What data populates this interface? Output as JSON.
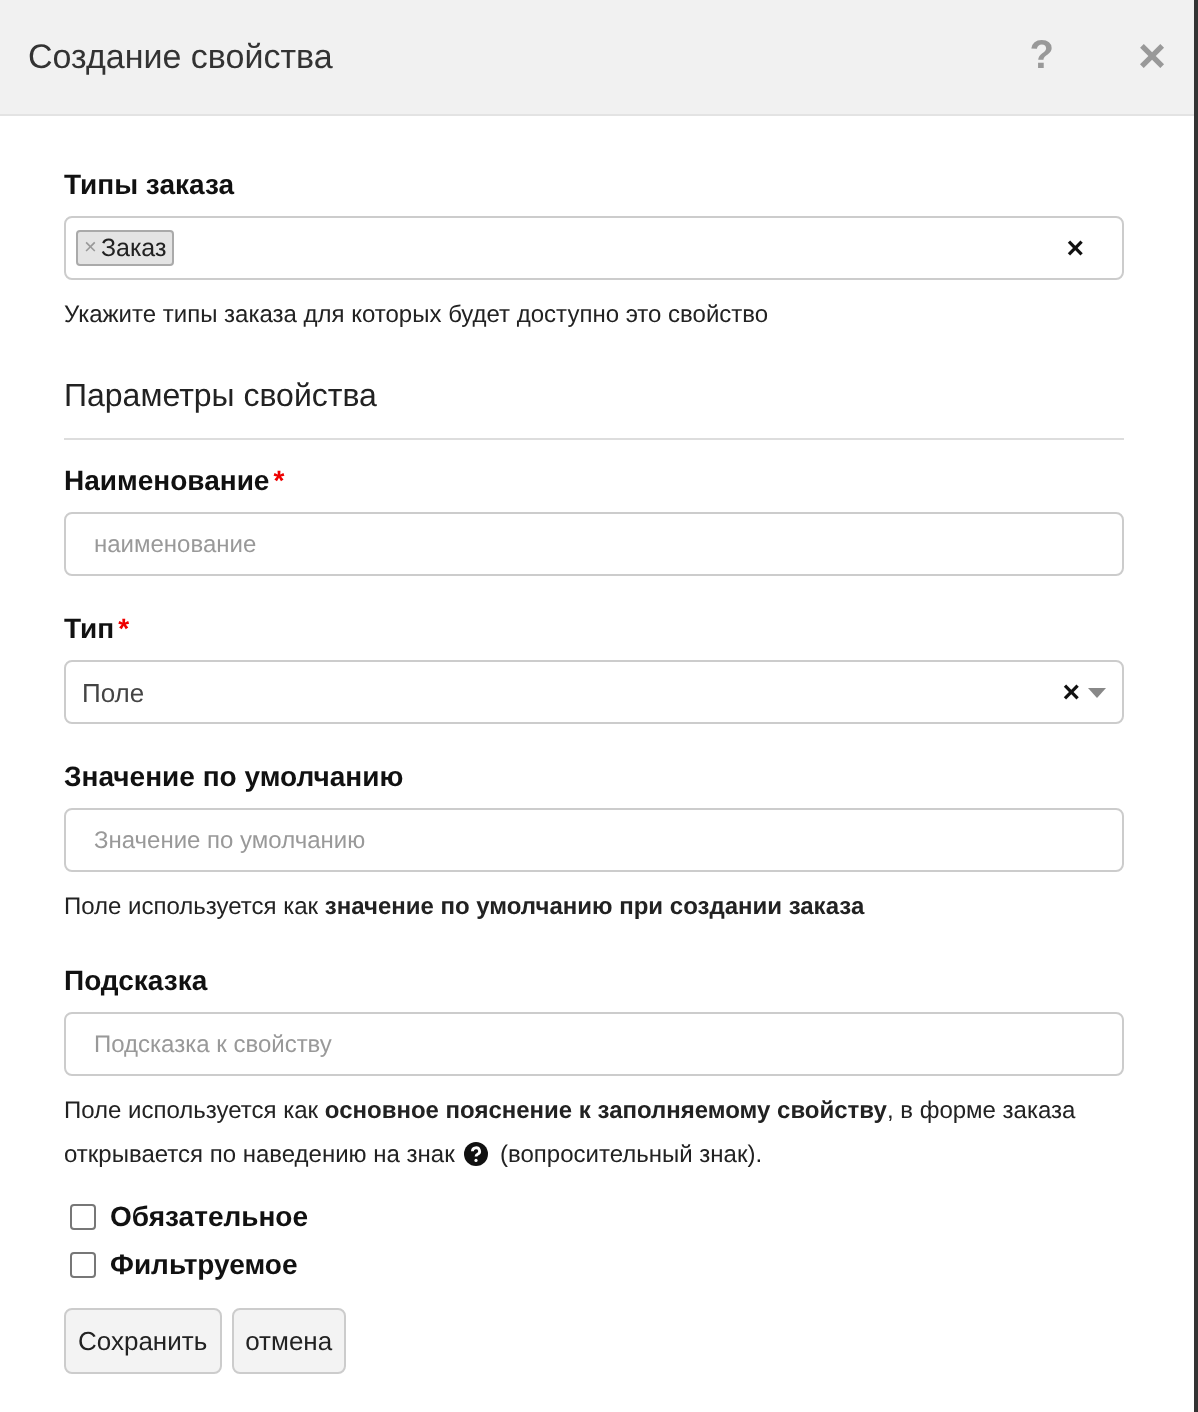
{
  "window": {
    "title": "Создание свойства"
  },
  "header_buttons": [
    {
      "kind": "help",
      "label": "?"
    },
    {
      "kind": "close",
      "label": "×"
    }
  ],
  "fields": [
    {
      "kind": "tags",
      "label": "Типы заказа",
      "tags": [
        {
          "remove": "×",
          "label": "Заказ"
        }
      ],
      "clear": "×",
      "hint": "Укажите типы заказа для которых будет доступно это свойство"
    },
    {
      "kind": "heading",
      "label": "Параметры свойства"
    },
    {
      "kind": "text",
      "label": "Наименование",
      "required_mark": "*",
      "placeholder": "наименование"
    },
    {
      "kind": "select",
      "label": "Тип",
      "required_mark": "*",
      "value": "Поле",
      "clear": "×"
    },
    {
      "kind": "text",
      "label": "Значение по умолчанию",
      "placeholder": "Значение по умолчанию",
      "hint": "Поле используется как **значение по умолчанию при создании заказа**"
    },
    {
      "kind": "text",
      "label": "Подсказка",
      "placeholder": "Подсказка к свойству",
      "hint": "Поле используется как **основное пояснение к заполняемому свойству**, в форме заказа открывается по наведению на знак",
      "hint_after": "(вопросительный знак)."
    },
    {
      "kind": "checkbox",
      "label": "Обязательное",
      "checked": false
    },
    {
      "kind": "checkbox",
      "label": "Фильтруемое",
      "checked": false
    }
  ],
  "buttons": [
    "Сохранить",
    "отмена"
  ]
}
